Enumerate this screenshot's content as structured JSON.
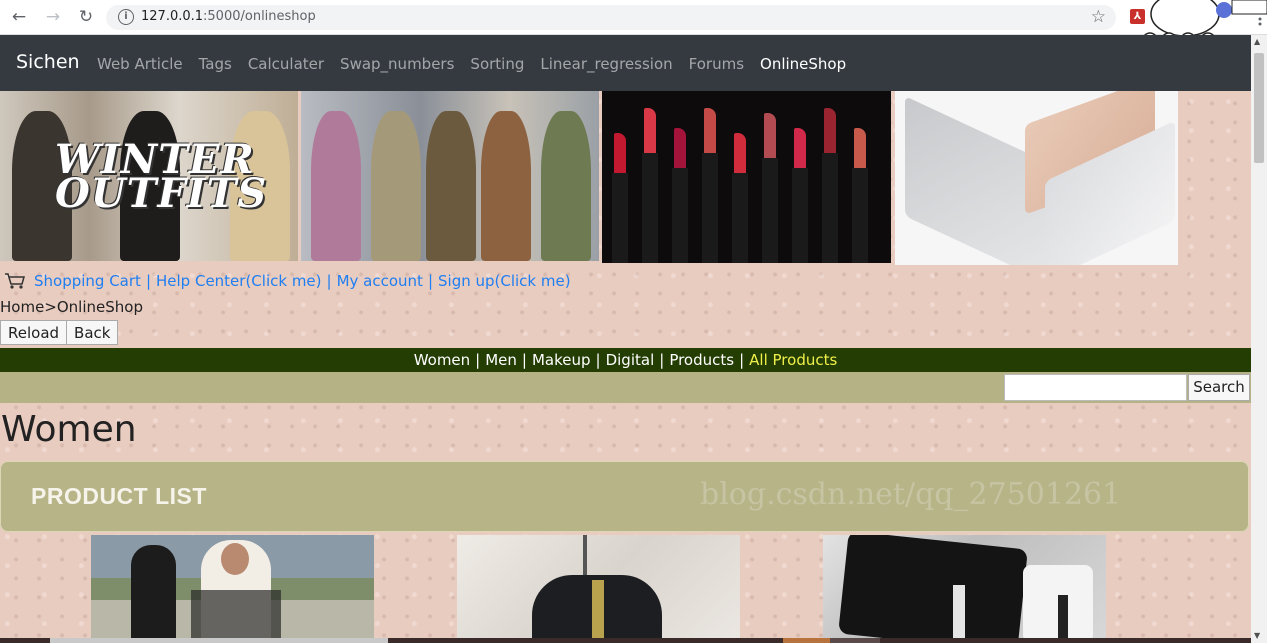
{
  "browser": {
    "url_host": "127.0.0.1",
    "url_path": ":5000/onlineshop"
  },
  "navbar": {
    "brand": "Sichen",
    "links": [
      "Web Article",
      "Tags",
      "Calculater",
      "Swap_numbers",
      "Sorting",
      "Linear_regression",
      "Forums",
      "OnlineShop"
    ],
    "active": "OnlineShop"
  },
  "banner": {
    "winter_line1": "WINTER",
    "winter_line2": "OUTFITS"
  },
  "top_links": {
    "cart": "Shopping Cart",
    "help": "Help Center(Click me)",
    "account": "My account",
    "signup": "Sign up(Click me)",
    "separator": "|"
  },
  "breadcrumb": "Home>OnlineShop",
  "buttons": {
    "reload": "Reload",
    "back": "Back"
  },
  "categories": {
    "items": [
      "Women",
      "Men",
      "Makeup",
      "Digital",
      "Products",
      "All Products"
    ],
    "separator": "|",
    "highlight_color": "#f0f04a"
  },
  "search": {
    "button": "Search",
    "value": ""
  },
  "section_title": "Women",
  "product_list": {
    "label": "PRODUCT LIST",
    "watermark": "blog.csdn.net/qq_27501261"
  },
  "colors": {
    "navbar_bg": "#343a40",
    "category_bar_bg": "#233d03",
    "search_row_bg": "#b5b385",
    "link_color": "#1e7ef2"
  }
}
